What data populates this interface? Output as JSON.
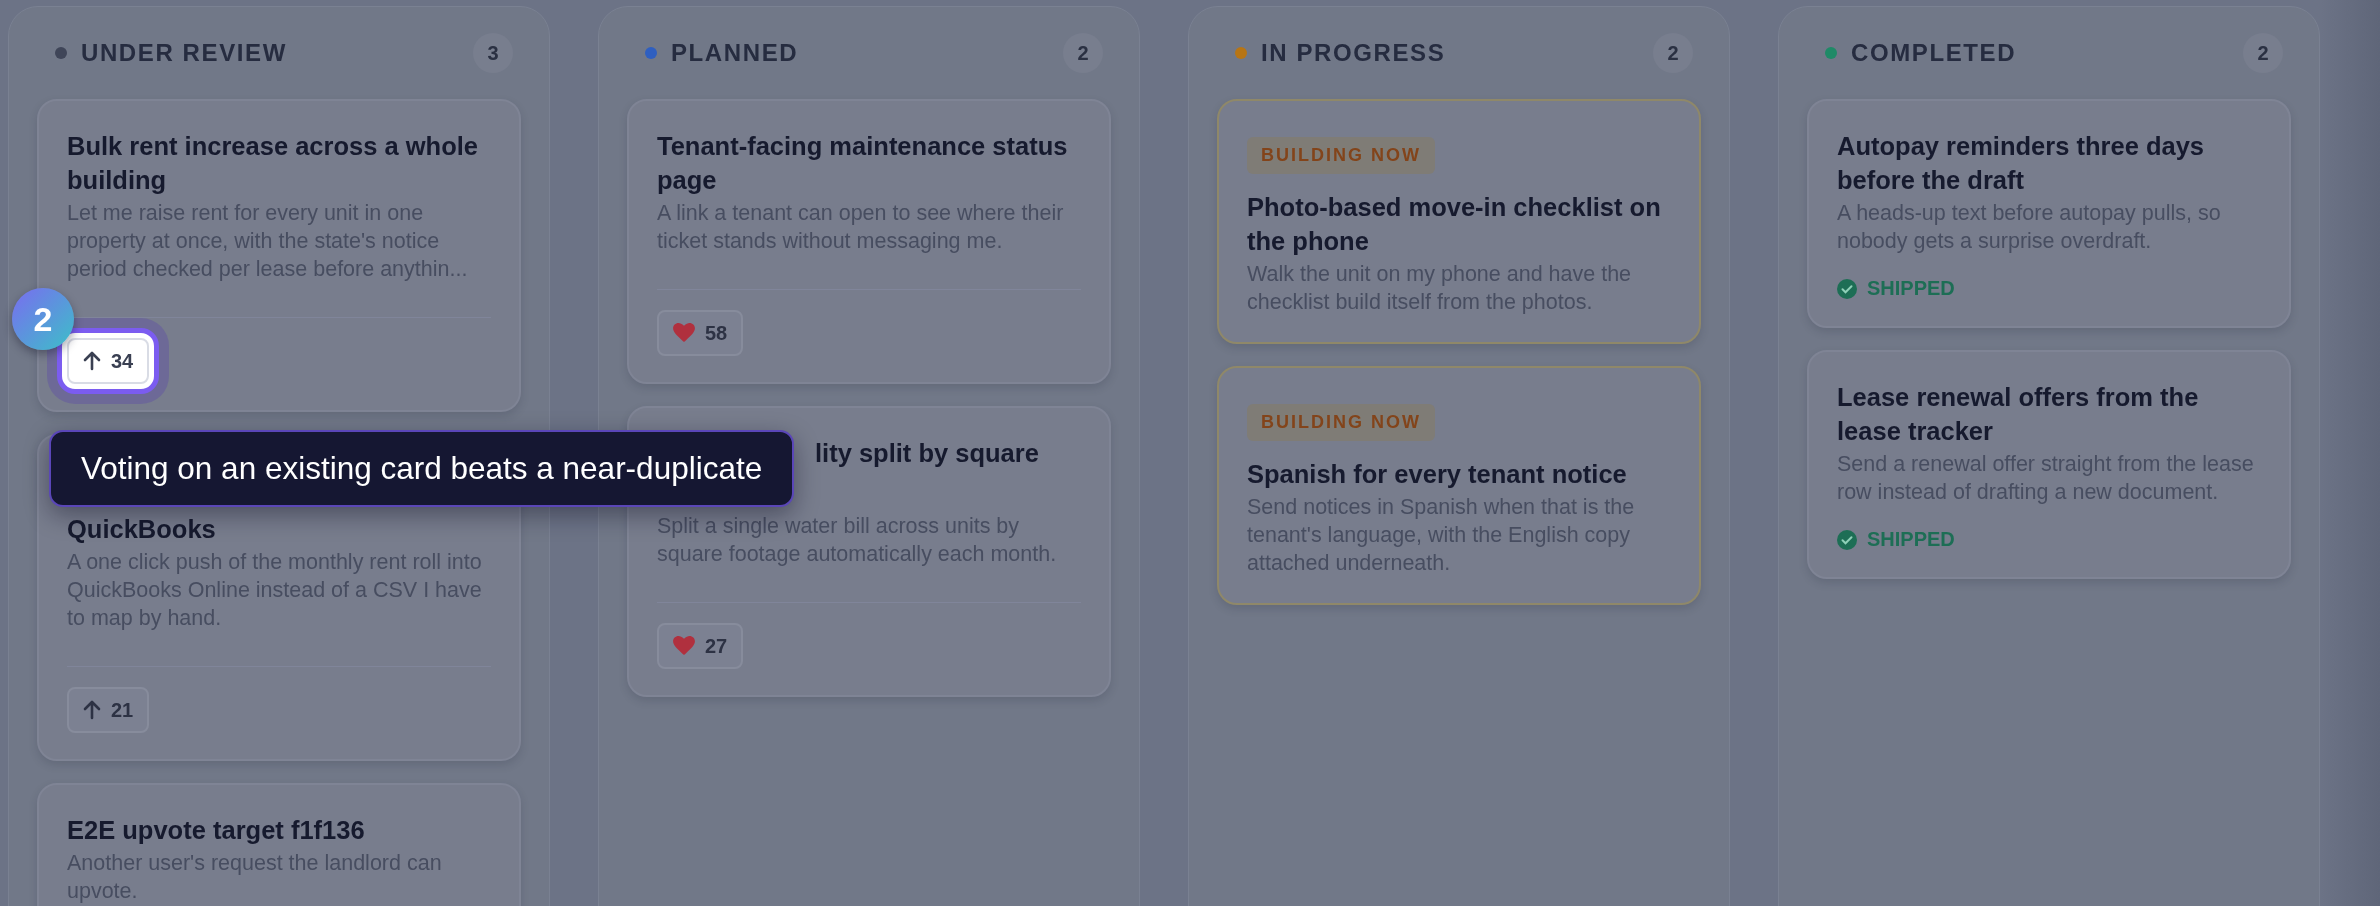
{
  "columns": [
    {
      "title": "UNDER REVIEW",
      "color": "#3f4558",
      "count": "3",
      "cards": [
        {
          "kind": "idea",
          "title": "Bulk rent increase across a whole building",
          "description": "Let me raise rent for every unit in one property at once, with the state's notice period checked per lease before anythin...",
          "vote": {
            "kind": "upvote",
            "count": "34",
            "highlighted": true
          }
        },
        {
          "kind": "idea",
          "title": "QuickBooks",
          "first_line_hidden": true,
          "description": "A one click push of the monthly rent roll into QuickBooks Online instead of a CSV I have to map by hand.",
          "vote": {
            "kind": "upvote",
            "count": "21",
            "highlighted": false
          }
        },
        {
          "kind": "idea",
          "title": "E2E upvote target f1f136",
          "description": "Another user's request the landlord can upvote."
        }
      ]
    },
    {
      "title": "PLANNED",
      "color": "#2f5fc0",
      "count": "2",
      "cards": [
        {
          "kind": "idea",
          "title": "Tenant-facing maintenance status page",
          "description": "A link a tenant can open to see where their ticket stands without messaging me.",
          "vote": {
            "kind": "like",
            "count": "58",
            "highlighted": false
          }
        },
        {
          "kind": "idea",
          "title": "lity split by square",
          "start_hidden": true,
          "description": "Split a single water bill across units by square footage automatically each month.",
          "vote": {
            "kind": "like",
            "count": "27",
            "highlighted": false
          }
        }
      ]
    },
    {
      "title": "IN PROGRESS",
      "color": "#b87514",
      "count": "2",
      "cards": [
        {
          "kind": "building",
          "badge": "BUILDING NOW",
          "title": "Photo-based move-in checklist on the phone",
          "description": "Walk the unit on my phone and have the checklist build itself from the photos."
        },
        {
          "kind": "building",
          "badge": "BUILDING NOW",
          "title": "Spanish for every tenant notice",
          "description": "Send notices in Spanish when that is the tenant's language, with the English copy attached underneath."
        }
      ]
    },
    {
      "title": "COMPLETED",
      "color": "#1f8a67",
      "count": "2",
      "cards": [
        {
          "kind": "shipped",
          "title": "Autopay reminders three days before the draft",
          "description": "A heads-up text before autopay pulls, so nobody gets a surprise overdraft.",
          "status": "SHIPPED"
        },
        {
          "kind": "shipped",
          "title": "Lease renewal offers from the lease tracker",
          "description": "Send a renewal offer straight from the lease row instead of drafting a new document.",
          "status": "SHIPPED"
        }
      ]
    }
  ],
  "tour": {
    "step": "2",
    "tooltip": "Voting on an existing card beats a near-duplicate"
  }
}
